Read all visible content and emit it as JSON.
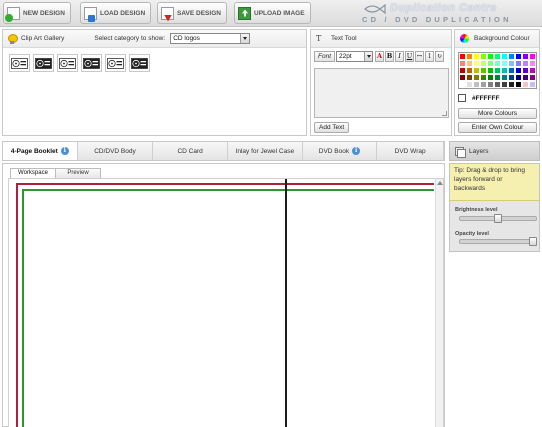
{
  "toolbar": {
    "new_design": "NEW DESIGN",
    "load_design": "LOAD DESIGN",
    "save_design": "SAVE DESIGN",
    "upload_image": "UPLOAD IMAGE"
  },
  "brand": {
    "name": "Duplication Centre",
    "tagline": "CD / DVD DUPLICATION"
  },
  "clipart": {
    "title": "Clip Art Gallery",
    "category_label": "Select category to show:",
    "category_value": "CD logos",
    "items": [
      "cd-logo-1",
      "cd-logo-2",
      "dvd-logo-1",
      "cd-logo-3",
      "cd-logo-4",
      "dvd-logo-2"
    ]
  },
  "text_tool": {
    "title": "Text Tool",
    "font_button": "Font",
    "size_value": "22pt",
    "add_text": "Add Text"
  },
  "background": {
    "title": "Background Colour",
    "current_value": "#FFFFFF",
    "more_colours": "More Colours",
    "enter_own": "Enter Own Colour",
    "swatches": [
      "#ff0000",
      "#ff8000",
      "#ffff00",
      "#80ff00",
      "#00ff00",
      "#00ff80",
      "#00ffff",
      "#0080ff",
      "#0000ff",
      "#8000ff",
      "#ff00ff",
      "#ff8080",
      "#ffc080",
      "#ffff80",
      "#c0ff80",
      "#80ff80",
      "#80ffc0",
      "#80ffff",
      "#80c0ff",
      "#8080ff",
      "#c080ff",
      "#ff80ff",
      "#c00000",
      "#c06000",
      "#c0c000",
      "#60c000",
      "#00c000",
      "#00c060",
      "#00c0c0",
      "#0060c0",
      "#0000c0",
      "#6000c0",
      "#c000c0",
      "#800000",
      "#804000",
      "#808000",
      "#408000",
      "#008000",
      "#008040",
      "#008080",
      "#004080",
      "#000080",
      "#400080",
      "#800080",
      "#ffffff",
      "#e0e0e0",
      "#c0c0c0",
      "#a0a0a0",
      "#808080",
      "#606060",
      "#404040",
      "#202020",
      "#000000",
      "#ffc0c0",
      "#c0c0ff"
    ]
  },
  "tabs": [
    {
      "label": "4-Page Booklet",
      "info": true,
      "active": true
    },
    {
      "label": "CD/DVD Body",
      "info": false,
      "active": false
    },
    {
      "label": "CD Card",
      "info": false,
      "active": false
    },
    {
      "label": "Inlay for Jewel Case",
      "info": false,
      "active": false
    },
    {
      "label": "DVD Book",
      "info": true,
      "active": false
    },
    {
      "label": "DVD Wrap",
      "info": false,
      "active": false
    }
  ],
  "info_glyph": "i",
  "workspace": {
    "tab_workspace": "Workspace",
    "tab_preview": "Preview"
  },
  "layers": {
    "title": "Layers",
    "tip": "Tip: Drag & drop to bring layers forward or backwards",
    "brightness_label": "Brightness level",
    "brightness_level": 0.5,
    "opacity_label": "Opacity level",
    "opacity_level": 1.0
  },
  "colors": {
    "bleed_line": "#b0203e",
    "safe_line": "#2d9630",
    "fold_line": "#1d1d1d"
  }
}
